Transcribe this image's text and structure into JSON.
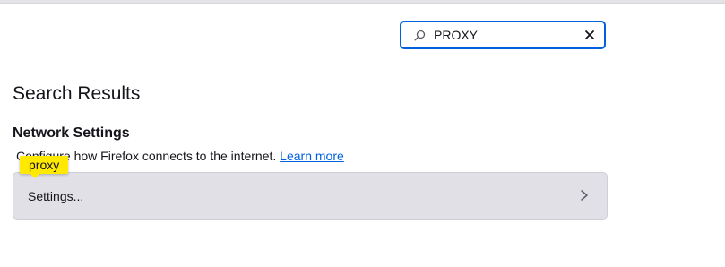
{
  "search": {
    "value": "PROXY",
    "icon": "magnifier-icon",
    "clear_icon": "close-icon"
  },
  "results": {
    "heading": "Search Results",
    "section_title": "Network Settings",
    "description": "Configure how Firefox connects to the internet.",
    "learn_more": "Learn more",
    "highlight": "proxy",
    "settings_button": {
      "label_first": "S",
      "label_accesskey": "e",
      "label_rest": "ttings..."
    }
  },
  "colors": {
    "accent": "#0061e0",
    "highlight": "#ffe900",
    "button_bg": "#e0e0e6"
  }
}
